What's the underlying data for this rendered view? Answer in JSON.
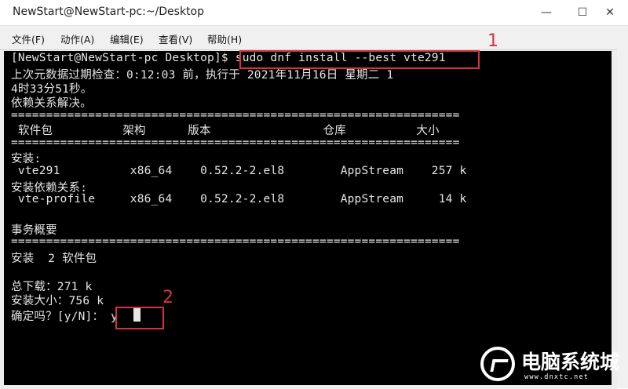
{
  "window": {
    "title": "NewStart@NewStart-pc:~/Desktop",
    "controls": {
      "minimize": "—",
      "maximize": "☐",
      "close": "✕"
    }
  },
  "menu": [
    "文件(F)",
    "动作(A)",
    "编辑(E)",
    "查看(V)",
    "帮助(H)"
  ],
  "terminal": {
    "prompt": "[NewStart@NewStart-pc Desktop]$ ",
    "command": "sudo dnf install --best vte291",
    "lines": [
      "上次元数据过期检查：0:12:03 前，执行于 2021年11月16日 星期二 1",
      "4时33分51秒。",
      "依赖关系解决。",
      "================================================================",
      " 软件包          架构      版本                仓库          大小",
      "================================================================",
      "安装:",
      " vte291          x86_64    0.52.2-2.el8        AppStream    257 k",
      "安装依赖关系:",
      " vte-profile     x86_64    0.52.2-2.el8        AppStream     14 k",
      "",
      "事务概要",
      "================================================================",
      "安装  2 软件包",
      "",
      "总下载：271 k",
      "安装大小：756 k",
      "确定吗？[y/N]： y"
    ]
  },
  "annotations": {
    "marker1": "1",
    "marker2": "2"
  },
  "watermark": {
    "text": "电脑系统城",
    "url": "www.dnxtc.net"
  },
  "colors": {
    "accent": "#d8333a",
    "terminal_bg": "#000000",
    "terminal_fg": "#e6e6e6"
  }
}
